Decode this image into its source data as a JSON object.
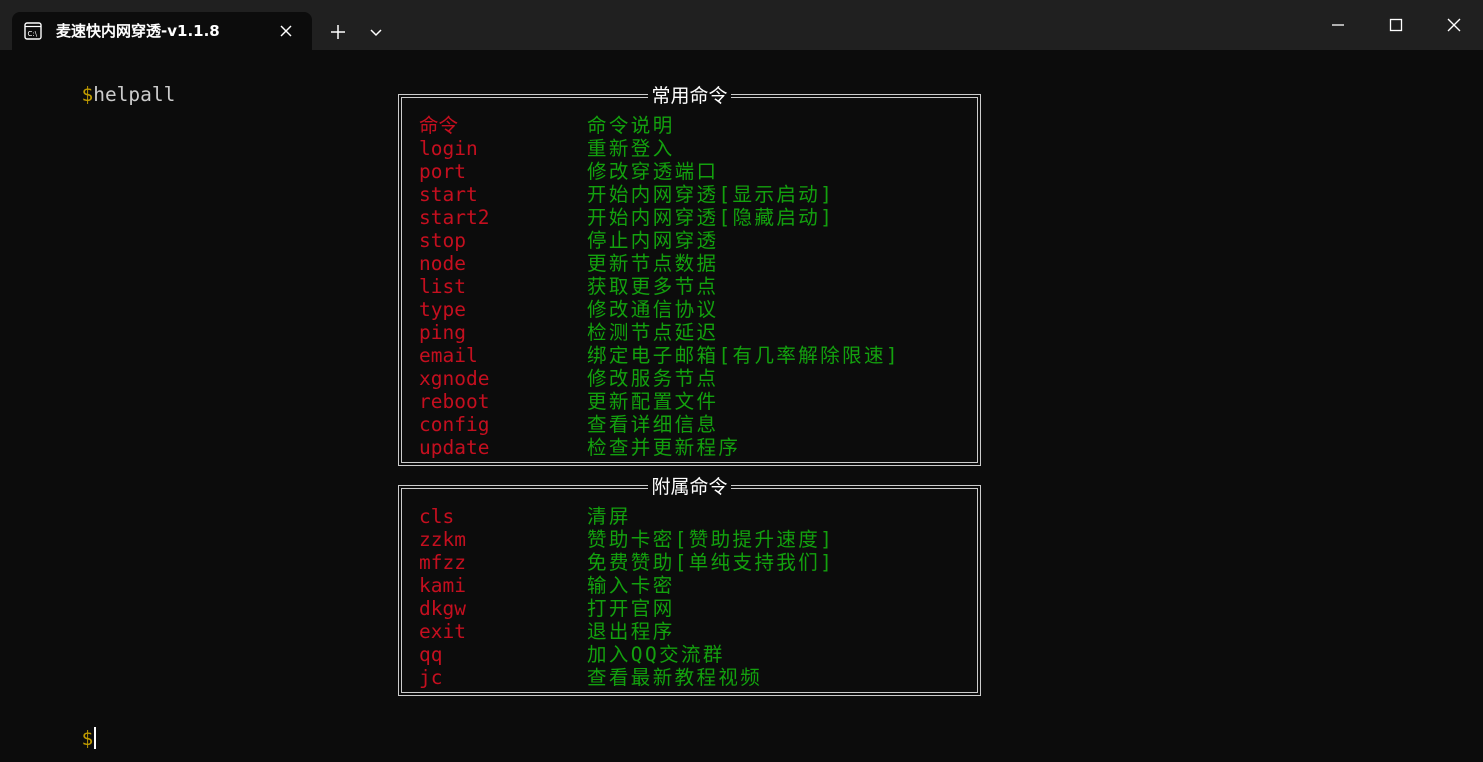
{
  "window": {
    "tab_title": "麦速快内网穿透-v1.1.8",
    "colors": {
      "titlebar": "#202020",
      "background": "#0c0c0c",
      "prompt": "#c19c00",
      "command": "#c50f1f",
      "description": "#13a10e"
    }
  },
  "terminal": {
    "prompt_symbol": "$",
    "first_command": "helpall",
    "last_prompt": "$"
  },
  "common_box": {
    "title": "常用命令",
    "rows": [
      {
        "cmd": "命令",
        "desc": "命令说明"
      },
      {
        "cmd": "login",
        "desc": "重新登入"
      },
      {
        "cmd": "port",
        "desc": "修改穿透端口"
      },
      {
        "cmd": "start",
        "desc": "开始内网穿透[显示启动]"
      },
      {
        "cmd": "start2",
        "desc": "开始内网穿透[隐藏启动]"
      },
      {
        "cmd": "stop",
        "desc": "停止内网穿透"
      },
      {
        "cmd": "node",
        "desc": "更新节点数据"
      },
      {
        "cmd": "list",
        "desc": "获取更多节点"
      },
      {
        "cmd": "type",
        "desc": "修改通信协议"
      },
      {
        "cmd": "ping",
        "desc": "检测节点延迟"
      },
      {
        "cmd": "email",
        "desc": "绑定电子邮箱[有几率解除限速]"
      },
      {
        "cmd": "xgnode",
        "desc": "修改服务节点"
      },
      {
        "cmd": "reboot",
        "desc": "更新配置文件"
      },
      {
        "cmd": "config",
        "desc": "查看详细信息"
      },
      {
        "cmd": "update",
        "desc": "检查并更新程序"
      }
    ]
  },
  "extra_box": {
    "title": "附属命令",
    "rows": [
      {
        "cmd": "cls",
        "desc": "清屏"
      },
      {
        "cmd": "zzkm",
        "desc": "赞助卡密[赞助提升速度]"
      },
      {
        "cmd": "mfzz",
        "desc": "免费赞助[单纯支持我们]"
      },
      {
        "cmd": "kami",
        "desc": "输入卡密"
      },
      {
        "cmd": "dkgw",
        "desc": "打开官网"
      },
      {
        "cmd": "exit",
        "desc": "退出程序"
      },
      {
        "cmd": "qq",
        "desc": "加入QQ交流群"
      },
      {
        "cmd": "jc",
        "desc": "查看最新教程视频"
      }
    ]
  }
}
